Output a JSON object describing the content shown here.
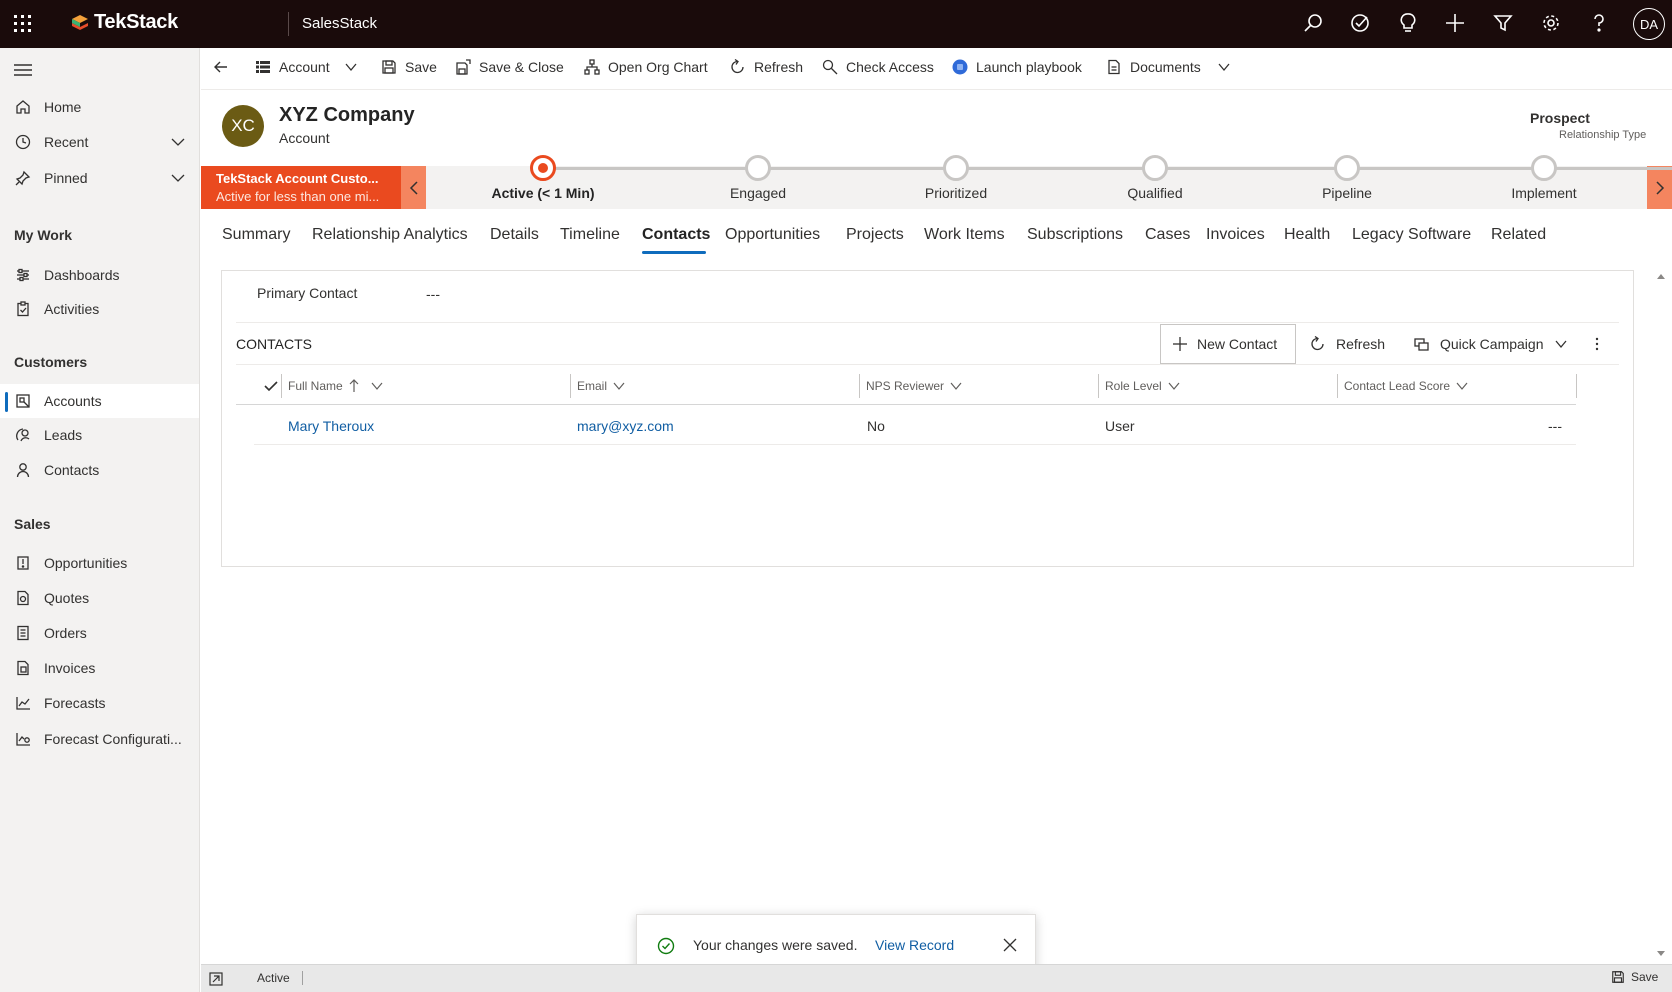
{
  "header": {
    "brand": "TekStack",
    "app_name": "SalesStack",
    "user_initials": "DA",
    "icons": [
      "search-icon",
      "task-icon",
      "lightbulb-icon",
      "plus-icon",
      "filter-icon",
      "gear-icon",
      "help-icon"
    ]
  },
  "sidebar": {
    "top": [
      {
        "label": "Home",
        "icon": "home-icon"
      },
      {
        "label": "Recent",
        "icon": "clock-icon"
      },
      {
        "label": "Pinned",
        "icon": "pin-icon"
      }
    ],
    "groups": [
      {
        "title": "My Work",
        "items": [
          "Dashboards",
          "Activities"
        ]
      },
      {
        "title": "Customers",
        "items": [
          "Accounts",
          "Leads",
          "Contacts"
        ]
      },
      {
        "title": "Sales",
        "items": [
          "Opportunities",
          "Quotes",
          "Orders",
          "Invoices",
          "Forecasts",
          "Forecast Configurati..."
        ]
      }
    ],
    "selected": "Accounts"
  },
  "commands": {
    "account": "Account",
    "save": "Save",
    "save_close": "Save & Close",
    "org_chart": "Open Org Chart",
    "refresh": "Refresh",
    "check_access": "Check Access",
    "playbook": "Launch playbook",
    "documents": "Documents"
  },
  "record": {
    "initials": "XC",
    "name": "XYZ Company",
    "entity": "Account",
    "relationship_value": "Prospect",
    "relationship_label": "Relationship Type"
  },
  "bpf": {
    "process_name": "TekStack Account Custo...",
    "process_status": "Active for less than one mi...",
    "stages": [
      "Active  (< 1 Min)",
      "Engaged",
      "Prioritized",
      "Qualified",
      "Pipeline",
      "Implement"
    ],
    "active_index": 0
  },
  "tabs": [
    "Summary",
    "Relationship Analytics",
    "Details",
    "Timeline",
    "Contacts",
    "Opportunities",
    "Projects",
    "Work Items",
    "Subscriptions",
    "Cases",
    "Invoices",
    "Health",
    "Legacy Software",
    "Related"
  ],
  "selected_tab": "Contacts",
  "form": {
    "primary_contact_label": "Primary Contact",
    "primary_contact_value": "---"
  },
  "grid": {
    "title": "CONTACTS",
    "new_contact": "New Contact",
    "refresh": "Refresh",
    "quick_campaign": "Quick Campaign",
    "columns": [
      "Full Name",
      "Email",
      "NPS Reviewer",
      "Role Level",
      "Contact Lead Score"
    ],
    "rows": [
      {
        "full_name": "Mary Theroux",
        "email": "mary@xyz.com",
        "nps": "No",
        "role": "User",
        "score": "---"
      }
    ]
  },
  "toast": {
    "message": "Your changes were saved.",
    "link": "View Record"
  },
  "footer": {
    "status": "Active",
    "save": "Save"
  },
  "colors": {
    "topbar": "#1a0b0b",
    "accent": "#0f6cbd",
    "bpf_active": "#ea4a1f",
    "link": "#115ea3"
  }
}
